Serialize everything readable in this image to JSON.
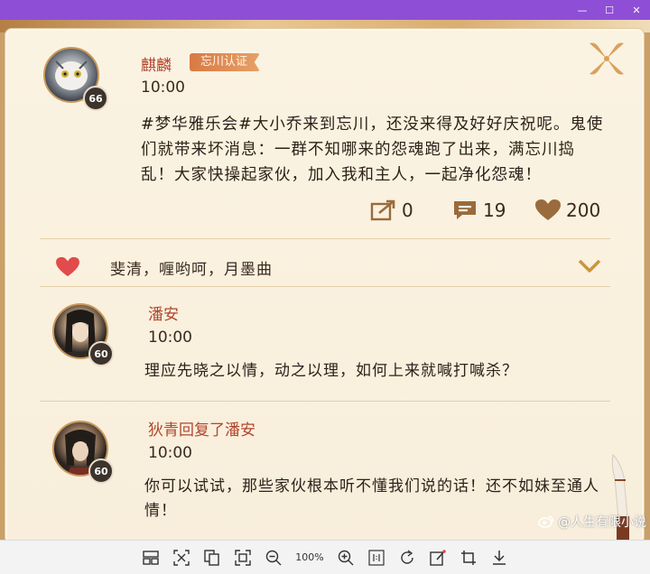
{
  "window": {
    "minimize_glyph": "—",
    "maximize_glyph": "☐",
    "close_glyph": "✕"
  },
  "post": {
    "author": "麒麟",
    "badge": "忘川认证",
    "level": "66",
    "time": "10:00",
    "text": "#梦华雅乐会#大小乔来到忘川，还没来得及好好庆祝呢。鬼使们就带来坏消息：一群不知哪来的怨魂跑了出来，满忘川捣乱！大家快操起家伙，加入我和主人，一起净化怨魂！",
    "shares": "0",
    "comments": "19",
    "likes": "200"
  },
  "liked_by": "斐清，喱哟呵，月墨曲",
  "comments": [
    {
      "author": "潘安",
      "level": "60",
      "time": "10:00",
      "text": "理应先晓之以情，动之以理，如何上来就喊打喊杀？"
    },
    {
      "author": "狄青回复了潘安",
      "level": "60",
      "time": "10:00",
      "text": "你可以试试，那些家伙根本听不懂我们说的话！还不如妹至通人情！"
    }
  ],
  "watermark": "@人生有限小说",
  "toolbar": {
    "zoom": "100%"
  },
  "colors": {
    "titlebar": "#8e4fd6",
    "name": "#b1452c",
    "heart": "#e24b4b"
  }
}
